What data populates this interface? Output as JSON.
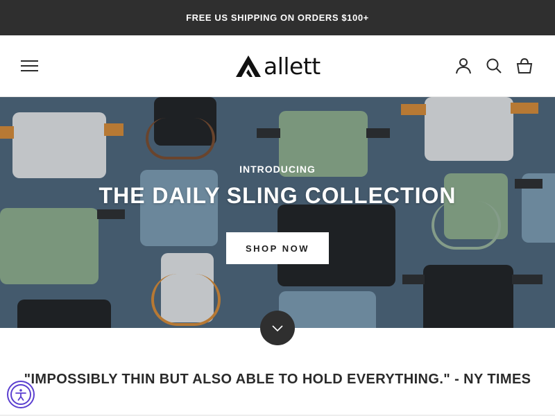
{
  "announcement": {
    "text": "FREE US SHIPPING ON ORDERS $100+"
  },
  "header": {
    "logo_text": "allett",
    "menu_icon": "hamburger-menu-icon",
    "account_icon": "user-account-icon",
    "search_icon": "search-icon",
    "cart_icon": "shopping-basket-icon"
  },
  "hero": {
    "eyebrow": "INTRODUCING",
    "title": "THE DAILY SLING COLLECTION",
    "cta_label": "SHOP NOW",
    "scroll_icon": "chevron-down-icon",
    "background_color": "#4d6478"
  },
  "quote": {
    "text": "\"IMPOSSIBLY THIN BUT ALSO ABLE TO HOLD EVERYTHING.\" - NY TIMES"
  },
  "accessibility": {
    "icon": "accessibility-person-icon",
    "accent_color": "#5b3fd0"
  },
  "colors": {
    "announcement_bg": "#2f2f2f",
    "bag_white": "#e6e6e6",
    "bag_sage": "#8fae8a",
    "bag_blue": "#7d9cb0",
    "bag_black": "#1f1f1f",
    "strap_orange": "#d98a32"
  }
}
